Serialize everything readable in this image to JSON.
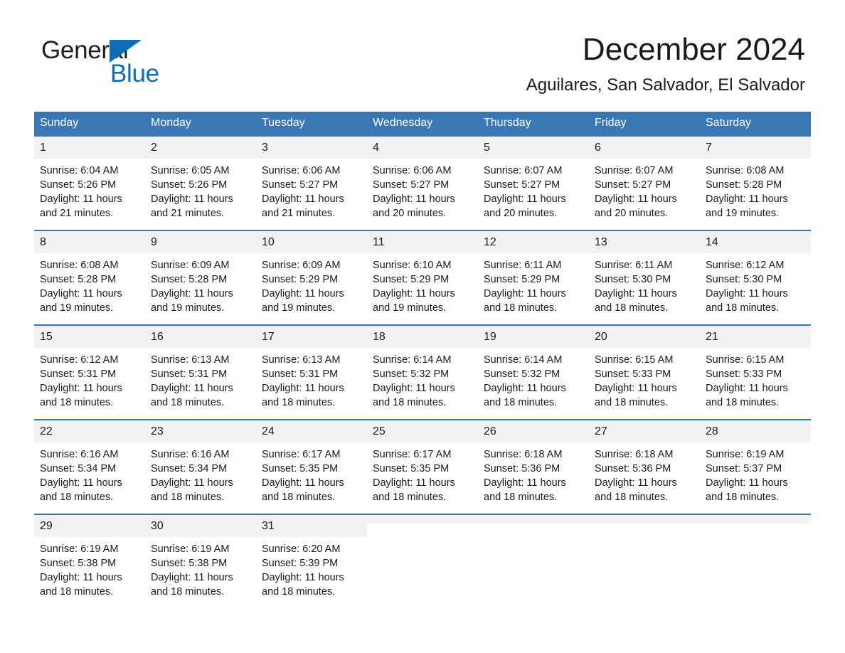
{
  "brand": {
    "name_part1": "General",
    "name_part2": "Blue",
    "triangle_icon": "brand-triangle-icon",
    "accent_color": "#0f6cb6"
  },
  "header": {
    "month_title": "December 2024",
    "location": "Aguilares, San Salvador, El Salvador"
  },
  "calendar": {
    "header_color": "#3a77b5",
    "day_strip_color": "#f2f2f2",
    "weekdays": [
      "Sunday",
      "Monday",
      "Tuesday",
      "Wednesday",
      "Thursday",
      "Friday",
      "Saturday"
    ],
    "weeks": [
      [
        {
          "day": "1",
          "sunrise": "Sunrise: 6:04 AM",
          "sunset": "Sunset: 5:26 PM",
          "daylight": "Daylight: 11 hours and 21 minutes."
        },
        {
          "day": "2",
          "sunrise": "Sunrise: 6:05 AM",
          "sunset": "Sunset: 5:26 PM",
          "daylight": "Daylight: 11 hours and 21 minutes."
        },
        {
          "day": "3",
          "sunrise": "Sunrise: 6:06 AM",
          "sunset": "Sunset: 5:27 PM",
          "daylight": "Daylight: 11 hours and 21 minutes."
        },
        {
          "day": "4",
          "sunrise": "Sunrise: 6:06 AM",
          "sunset": "Sunset: 5:27 PM",
          "daylight": "Daylight: 11 hours and 20 minutes."
        },
        {
          "day": "5",
          "sunrise": "Sunrise: 6:07 AM",
          "sunset": "Sunset: 5:27 PM",
          "daylight": "Daylight: 11 hours and 20 minutes."
        },
        {
          "day": "6",
          "sunrise": "Sunrise: 6:07 AM",
          "sunset": "Sunset: 5:27 PM",
          "daylight": "Daylight: 11 hours and 20 minutes."
        },
        {
          "day": "7",
          "sunrise": "Sunrise: 6:08 AM",
          "sunset": "Sunset: 5:28 PM",
          "daylight": "Daylight: 11 hours and 19 minutes."
        }
      ],
      [
        {
          "day": "8",
          "sunrise": "Sunrise: 6:08 AM",
          "sunset": "Sunset: 5:28 PM",
          "daylight": "Daylight: 11 hours and 19 minutes."
        },
        {
          "day": "9",
          "sunrise": "Sunrise: 6:09 AM",
          "sunset": "Sunset: 5:28 PM",
          "daylight": "Daylight: 11 hours and 19 minutes."
        },
        {
          "day": "10",
          "sunrise": "Sunrise: 6:09 AM",
          "sunset": "Sunset: 5:29 PM",
          "daylight": "Daylight: 11 hours and 19 minutes."
        },
        {
          "day": "11",
          "sunrise": "Sunrise: 6:10 AM",
          "sunset": "Sunset: 5:29 PM",
          "daylight": "Daylight: 11 hours and 19 minutes."
        },
        {
          "day": "12",
          "sunrise": "Sunrise: 6:11 AM",
          "sunset": "Sunset: 5:29 PM",
          "daylight": "Daylight: 11 hours and 18 minutes."
        },
        {
          "day": "13",
          "sunrise": "Sunrise: 6:11 AM",
          "sunset": "Sunset: 5:30 PM",
          "daylight": "Daylight: 11 hours and 18 minutes."
        },
        {
          "day": "14",
          "sunrise": "Sunrise: 6:12 AM",
          "sunset": "Sunset: 5:30 PM",
          "daylight": "Daylight: 11 hours and 18 minutes."
        }
      ],
      [
        {
          "day": "15",
          "sunrise": "Sunrise: 6:12 AM",
          "sunset": "Sunset: 5:31 PM",
          "daylight": "Daylight: 11 hours and 18 minutes."
        },
        {
          "day": "16",
          "sunrise": "Sunrise: 6:13 AM",
          "sunset": "Sunset: 5:31 PM",
          "daylight": "Daylight: 11 hours and 18 minutes."
        },
        {
          "day": "17",
          "sunrise": "Sunrise: 6:13 AM",
          "sunset": "Sunset: 5:31 PM",
          "daylight": "Daylight: 11 hours and 18 minutes."
        },
        {
          "day": "18",
          "sunrise": "Sunrise: 6:14 AM",
          "sunset": "Sunset: 5:32 PM",
          "daylight": "Daylight: 11 hours and 18 minutes."
        },
        {
          "day": "19",
          "sunrise": "Sunrise: 6:14 AM",
          "sunset": "Sunset: 5:32 PM",
          "daylight": "Daylight: 11 hours and 18 minutes."
        },
        {
          "day": "20",
          "sunrise": "Sunrise: 6:15 AM",
          "sunset": "Sunset: 5:33 PM",
          "daylight": "Daylight: 11 hours and 18 minutes."
        },
        {
          "day": "21",
          "sunrise": "Sunrise: 6:15 AM",
          "sunset": "Sunset: 5:33 PM",
          "daylight": "Daylight: 11 hours and 18 minutes."
        }
      ],
      [
        {
          "day": "22",
          "sunrise": "Sunrise: 6:16 AM",
          "sunset": "Sunset: 5:34 PM",
          "daylight": "Daylight: 11 hours and 18 minutes."
        },
        {
          "day": "23",
          "sunrise": "Sunrise: 6:16 AM",
          "sunset": "Sunset: 5:34 PM",
          "daylight": "Daylight: 11 hours and 18 minutes."
        },
        {
          "day": "24",
          "sunrise": "Sunrise: 6:17 AM",
          "sunset": "Sunset: 5:35 PM",
          "daylight": "Daylight: 11 hours and 18 minutes."
        },
        {
          "day": "25",
          "sunrise": "Sunrise: 6:17 AM",
          "sunset": "Sunset: 5:35 PM",
          "daylight": "Daylight: 11 hours and 18 minutes."
        },
        {
          "day": "26",
          "sunrise": "Sunrise: 6:18 AM",
          "sunset": "Sunset: 5:36 PM",
          "daylight": "Daylight: 11 hours and 18 minutes."
        },
        {
          "day": "27",
          "sunrise": "Sunrise: 6:18 AM",
          "sunset": "Sunset: 5:36 PM",
          "daylight": "Daylight: 11 hours and 18 minutes."
        },
        {
          "day": "28",
          "sunrise": "Sunrise: 6:19 AM",
          "sunset": "Sunset: 5:37 PM",
          "daylight": "Daylight: 11 hours and 18 minutes."
        }
      ],
      [
        {
          "day": "29",
          "sunrise": "Sunrise: 6:19 AM",
          "sunset": "Sunset: 5:38 PM",
          "daylight": "Daylight: 11 hours and 18 minutes."
        },
        {
          "day": "30",
          "sunrise": "Sunrise: 6:19 AM",
          "sunset": "Sunset: 5:38 PM",
          "daylight": "Daylight: 11 hours and 18 minutes."
        },
        {
          "day": "31",
          "sunrise": "Sunrise: 6:20 AM",
          "sunset": "Sunset: 5:39 PM",
          "daylight": "Daylight: 11 hours and 18 minutes."
        },
        {
          "day": "",
          "sunrise": "",
          "sunset": "",
          "daylight": ""
        },
        {
          "day": "",
          "sunrise": "",
          "sunset": "",
          "daylight": ""
        },
        {
          "day": "",
          "sunrise": "",
          "sunset": "",
          "daylight": ""
        },
        {
          "day": "",
          "sunrise": "",
          "sunset": "",
          "daylight": ""
        }
      ]
    ]
  }
}
